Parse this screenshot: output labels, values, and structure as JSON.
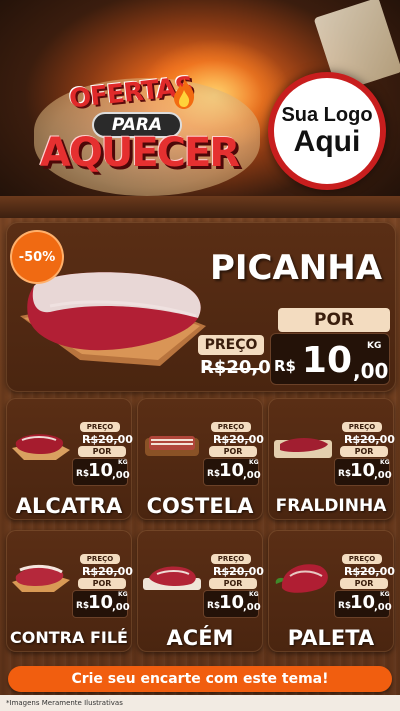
{
  "header": {
    "title_line1": "OFERTAS",
    "title_line2": "PARA",
    "title_line3": "AQUECER",
    "logo_line1": "Sua Logo",
    "logo_line2": "Aqui"
  },
  "featured": {
    "discount_badge": "-50%",
    "name": "PICANHA",
    "preco_label": "PREÇO",
    "por_label": "POR",
    "old_price": "R$20,00",
    "currency": "R$",
    "new_price_int": "10",
    "new_price_dec": ",00",
    "unit": "KG"
  },
  "products": [
    {
      "name": "ALCATRA",
      "preco_label": "PREÇO",
      "old_price": "R$20,00",
      "por_label": "POR",
      "currency": "R$",
      "price_int": "10",
      "price_dec": ",00",
      "unit": "KG"
    },
    {
      "name": "COSTELA",
      "preco_label": "PREÇO",
      "old_price": "R$20,00",
      "por_label": "POR",
      "currency": "R$",
      "price_int": "10",
      "price_dec": ",00",
      "unit": "KG"
    },
    {
      "name": "FRALDINHA",
      "preco_label": "PREÇO",
      "old_price": "R$20,00",
      "por_label": "POR",
      "currency": "R$",
      "price_int": "10",
      "price_dec": ",00",
      "unit": "KG"
    },
    {
      "name": "CONTRA FILÉ",
      "preco_label": "PREÇO",
      "old_price": "R$20,00",
      "por_label": "POR",
      "currency": "R$",
      "price_int": "10",
      "price_dec": ",00",
      "unit": "KG"
    },
    {
      "name": "ACÉM",
      "preco_label": "PREÇO",
      "old_price": "R$20,00",
      "por_label": "POR",
      "currency": "R$",
      "price_int": "10",
      "price_dec": ",00",
      "unit": "KG"
    },
    {
      "name": "PALETA",
      "preco_label": "PREÇO",
      "old_price": "R$20,00",
      "por_label": "POR",
      "currency": "R$",
      "price_int": "10",
      "price_dec": ",00",
      "unit": "KG"
    }
  ],
  "footer": {
    "cta_label": "Crie seu encarte com este tema!",
    "disclaimer": "*Imagens Meramente Ilustrativas"
  },
  "colors": {
    "accent_orange": "#f15e0f",
    "title_red": "#e02a2a",
    "wood_panel": "#4a2510",
    "price_pill": "#f3dcc0"
  }
}
